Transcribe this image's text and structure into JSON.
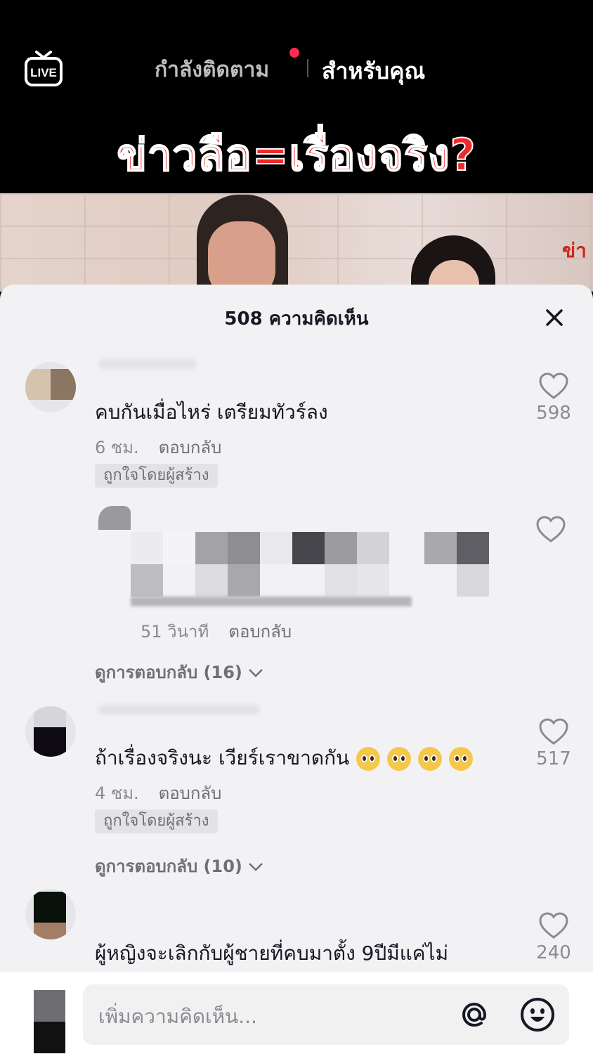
{
  "top_nav": {
    "live_icon": "live-tv-icon",
    "live_label": "LIVE",
    "tab_following": "กำลังติดตาม",
    "tab_for_you": "สำหรับคุณ",
    "notification_dot_color": "#fe2c55"
  },
  "video": {
    "headline": "ข่าวลือ=เรื่องจริง?",
    "overlay_text": "ข่า"
  },
  "comments_sheet": {
    "title": "508 ความคิดเห็น",
    "close_icon": "close-icon",
    "comments": [
      {
        "text": "คบกันเมื่อไหร่ เตรียมทัวร์ลง",
        "time": "6 ชม.",
        "reply_label": "ตอบกลับ",
        "badge": "ถูกใจโดยผู้สร้าง",
        "likes": "598"
      },
      {
        "reply_time": "51 วินาที",
        "reply_label": "ตอบกลับ",
        "view_replies": "ดูการตอบกลับ (16)"
      },
      {
        "text": "ถ้าเรื่องจริงนะ เวียร์เราขาดกัน",
        "time": "4 ชม.",
        "reply_label": "ตอบกลับ",
        "badge": "ถูกใจโดยผู้สร้าง",
        "likes": "517",
        "view_replies": "ดูการตอบกลับ (10)"
      },
      {
        "text": "ผู้หญิงจะเลิกกับผู้ชายที่คบมาตั้ง 9ปีมีแค่ไม่",
        "likes": "240"
      }
    ]
  },
  "input_bar": {
    "placeholder": "เพิ่มความคิดเห็น...",
    "mention_icon": "at-icon",
    "emoji_icon": "emoji-icon"
  }
}
